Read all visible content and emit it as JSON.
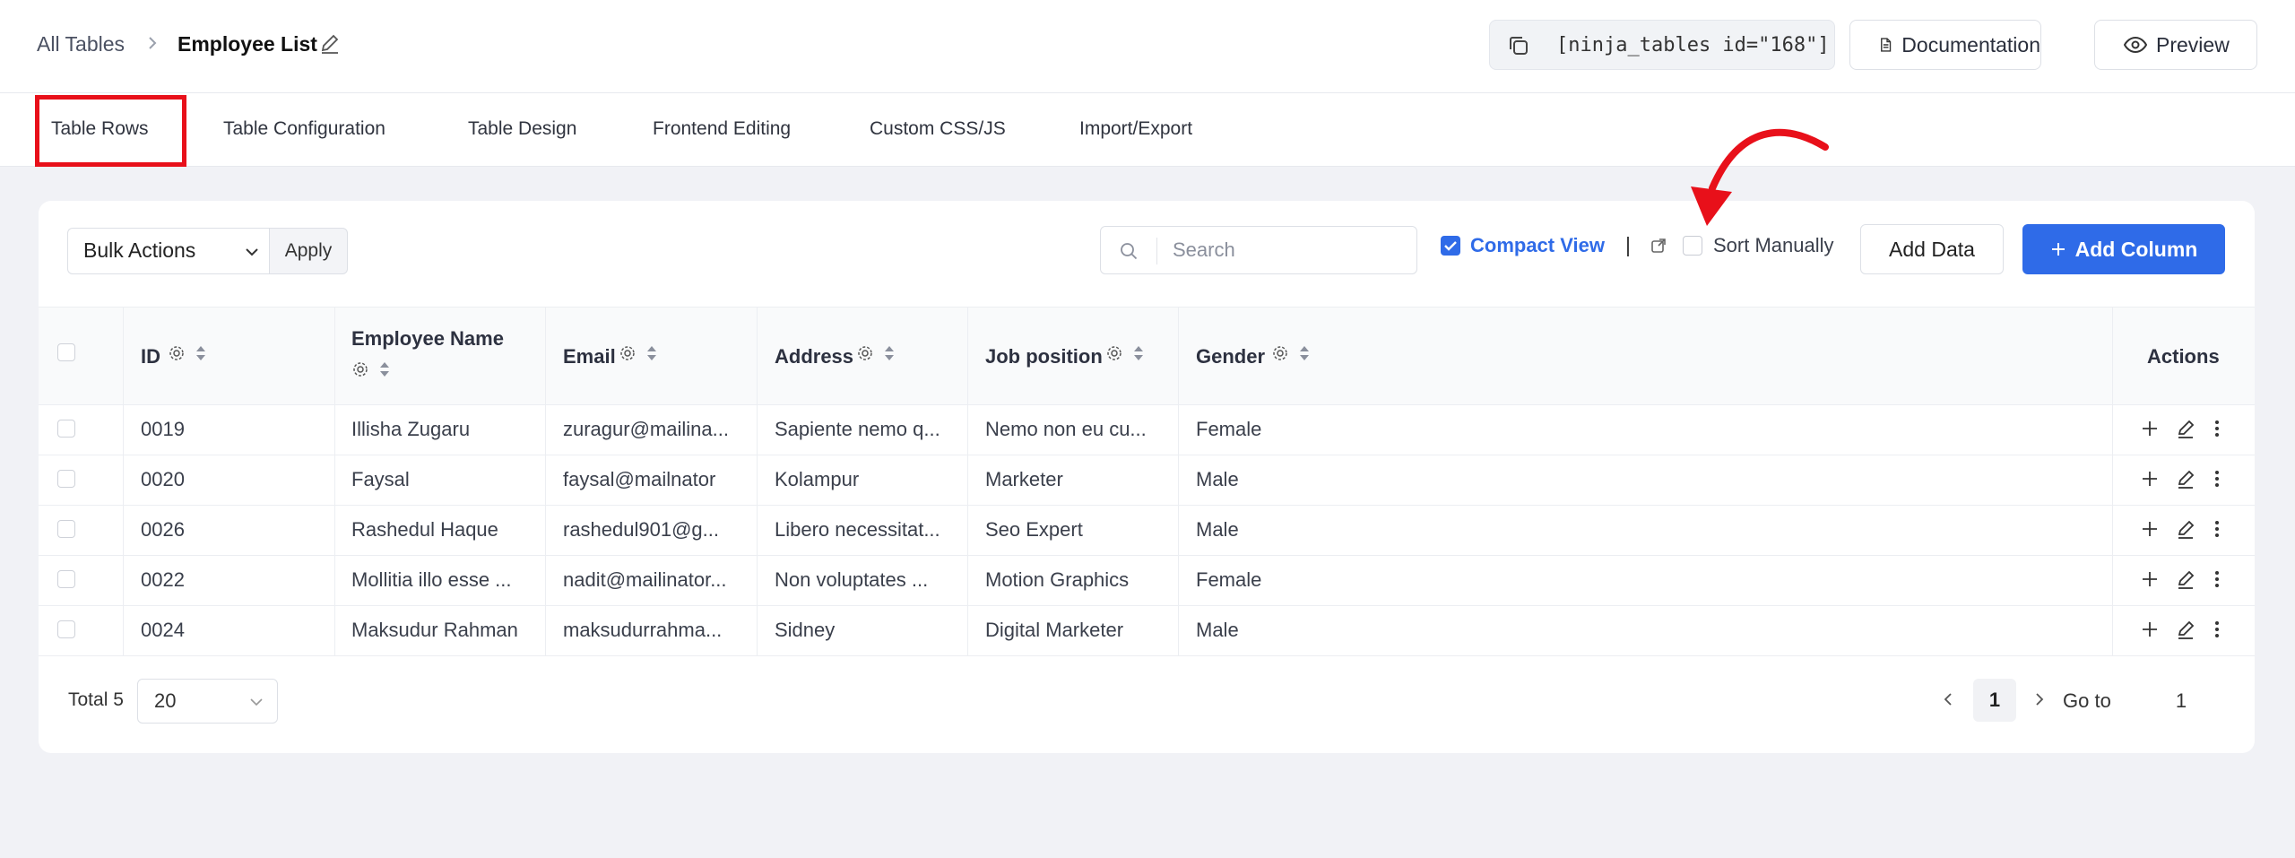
{
  "breadcrumb": {
    "root": "All Tables",
    "current": "Employee List"
  },
  "header": {
    "shortcode": "[ninja_tables id=\"168\"]",
    "documentation_label": "Documentation",
    "preview_label": "Preview"
  },
  "tabs": [
    {
      "label": "Table Rows",
      "active": true
    },
    {
      "label": "Table Configuration"
    },
    {
      "label": "Table Design"
    },
    {
      "label": "Frontend Editing"
    },
    {
      "label": "Custom CSS/JS"
    },
    {
      "label": "Import/Export"
    }
  ],
  "toolbar": {
    "bulk_actions": "Bulk Actions",
    "apply": "Apply",
    "search_placeholder": "Search",
    "compact_view": "Compact View",
    "compact_view_checked": true,
    "separator": "|",
    "sort_manually": "Sort Manually",
    "sort_manually_checked": false,
    "add_data": "Add Data",
    "add_column": "Add Column"
  },
  "table": {
    "columns": [
      "ID",
      "Employee Name",
      "Email",
      "Address",
      "Job position",
      "Gender",
      "Actions"
    ],
    "rows": [
      [
        "0019",
        "Illisha Zugaru",
        "zuragur@mailina...",
        "Sapiente nemo q...",
        "Nemo non eu cu...",
        "Female"
      ],
      [
        "0020",
        "Faysal",
        "faysal@mailnator",
        "Kolampur",
        "Marketer",
        "Male"
      ],
      [
        "0026",
        "Rashedul Haque",
        "rashedul901@g...",
        "Libero necessitat...",
        "Seo Expert",
        "Male"
      ],
      [
        "0022",
        "Mollitia illo esse ...",
        "nadit@mailinator...",
        "Non voluptates ...",
        "Motion Graphics",
        "Female"
      ],
      [
        "0024",
        "Maksudur Rahman",
        "maksudurrahma...",
        "Sidney",
        "Digital Marketer",
        "Male"
      ]
    ]
  },
  "footer": {
    "total": "Total 5",
    "page_size": "20",
    "current_page": "1",
    "goto_label": "Go to",
    "goto_value": "1"
  },
  "colors": {
    "accent": "#2f6be8",
    "annotation": "#e8101a"
  }
}
